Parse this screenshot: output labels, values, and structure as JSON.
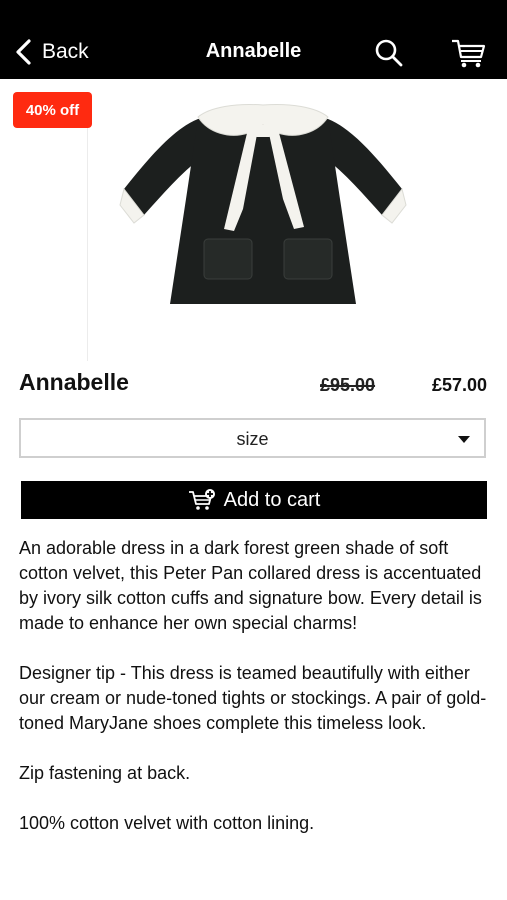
{
  "header": {
    "back_label": "Back",
    "title": "Annabelle",
    "icons": [
      "chevron-left-icon",
      "search-icon",
      "cart-icon"
    ]
  },
  "product": {
    "badge": "40% off",
    "name": "Annabelle",
    "old_price": "£95.00",
    "price": "£57.00",
    "size_placeholder": "size",
    "add_to_cart_label": "Add to cart",
    "description": [
      "An adorable dress in a dark forest green shade of soft cotton velvet, this Peter Pan collared dress is accentuated by ivory silk cotton cuffs and signature bow. Every detail is made to enhance her own special charms!",
      "Designer tip - This dress is teamed beautifully with either our cream or nude-toned tights or stockings. A pair of gold-toned MaryJane shoes complete this timeless look.",
      "Zip fastening at back.",
      "100% cotton velvet with cotton lining."
    ]
  },
  "colors": {
    "header_bg": "#000000",
    "badge_bg": "#ff2a10",
    "button_bg": "#000000",
    "dress": "#1c1f1e",
    "collar": "#f4f3ee"
  }
}
